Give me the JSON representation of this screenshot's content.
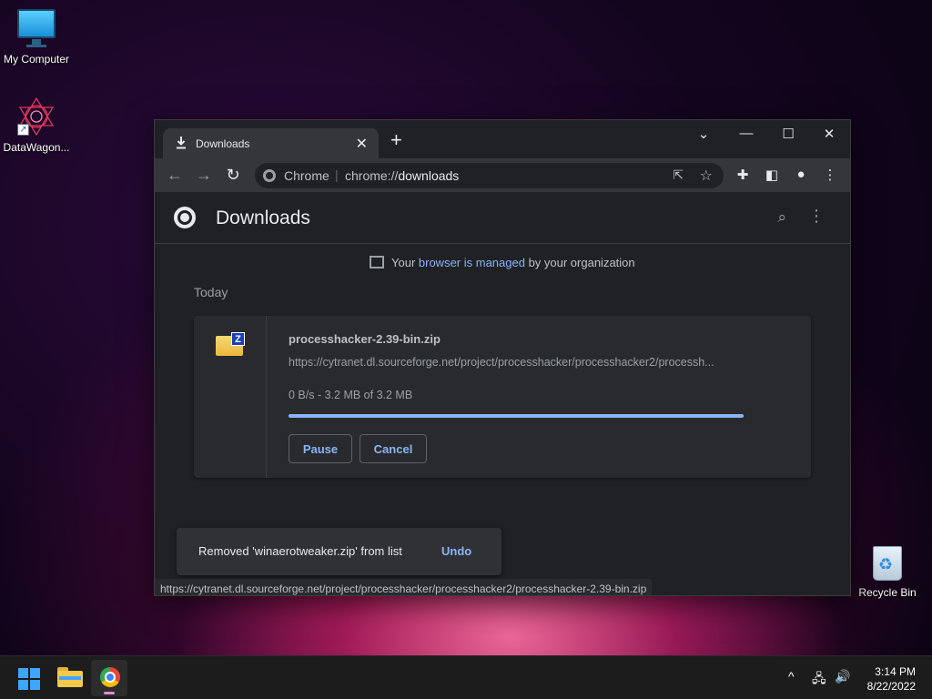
{
  "desktop": {
    "icons": [
      {
        "label": "My Computer"
      },
      {
        "label": "DataWagon..."
      },
      {
        "label": "Recycle Bin"
      }
    ]
  },
  "browser": {
    "tab": {
      "title": "Downloads",
      "close": "✕"
    },
    "new_tab": "+",
    "window_controls": {
      "dropdown": "⌄",
      "minimize": "—",
      "maximize": "☐",
      "close": "✕"
    },
    "omnibox": {
      "site_label": "Chrome",
      "separator": "|",
      "url_scheme": "chrome://",
      "url_host": "downloads"
    },
    "page": {
      "title": "Downloads",
      "managed_notice": {
        "prefix": "Your ",
        "link": "browser is managed",
        "suffix": " by your organization"
      },
      "section_label": "Today",
      "download": {
        "filename": "processhacker-2.39-bin.zip",
        "url": "https://cytranet.dl.sourceforge.net/project/processhacker/processhacker2/processh...",
        "status": "0 B/s - 3.2 MB of 3.2 MB",
        "progress": 1.0,
        "pause_label": "Pause",
        "cancel_label": "Cancel"
      },
      "toast": {
        "message": "Removed 'winaerotweaker.zip' from list",
        "undo_label": "Undo"
      },
      "status_url": "https://cytranet.dl.sourceforge.net/project/processhacker/processhacker2/processhacker-2.39-bin.zip"
    },
    "colors": {
      "accent": "#8ab4f8",
      "background": "#202124",
      "card": "#292a2d"
    }
  },
  "taskbar": {
    "clock": {
      "time": "3:14 PM",
      "date": "8/22/2022"
    },
    "tray": {
      "chevron": "^",
      "network": "🖧",
      "volume": "🔊"
    }
  }
}
